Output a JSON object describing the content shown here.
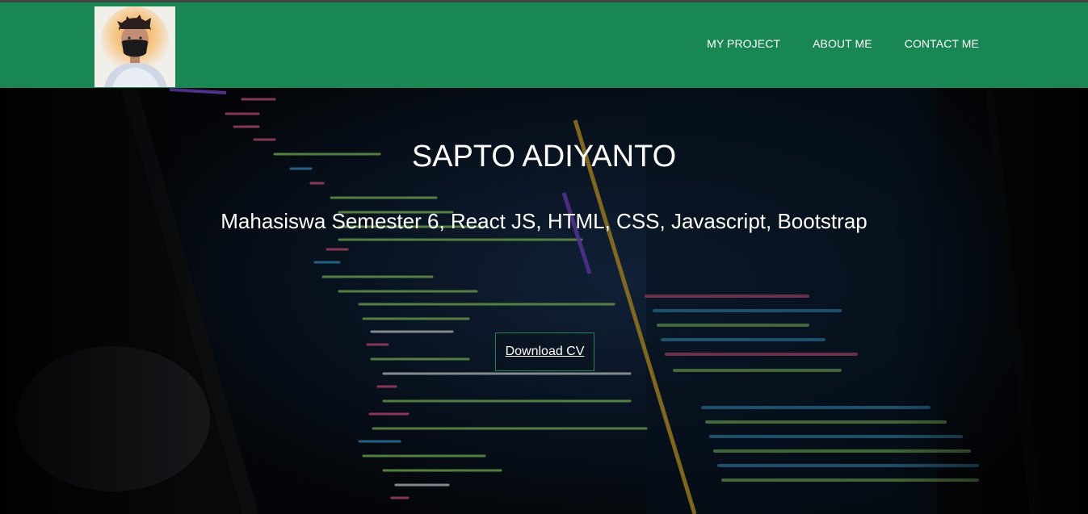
{
  "navbar": {
    "logo_icon": "profile-avatar-icon",
    "links": [
      {
        "label": "MY PROJECT"
      },
      {
        "label": "ABOUT ME"
      },
      {
        "label": "CONTACT ME"
      }
    ],
    "bg_color": "#198754"
  },
  "hero": {
    "title": "SAPTO ADIYANTO",
    "subtitle": "Mahasiswa Semester 6, React JS, HTML, CSS, Javascript, Bootstrap",
    "cta_label": "Download CV",
    "background": "code-editor-laptop-photo"
  }
}
